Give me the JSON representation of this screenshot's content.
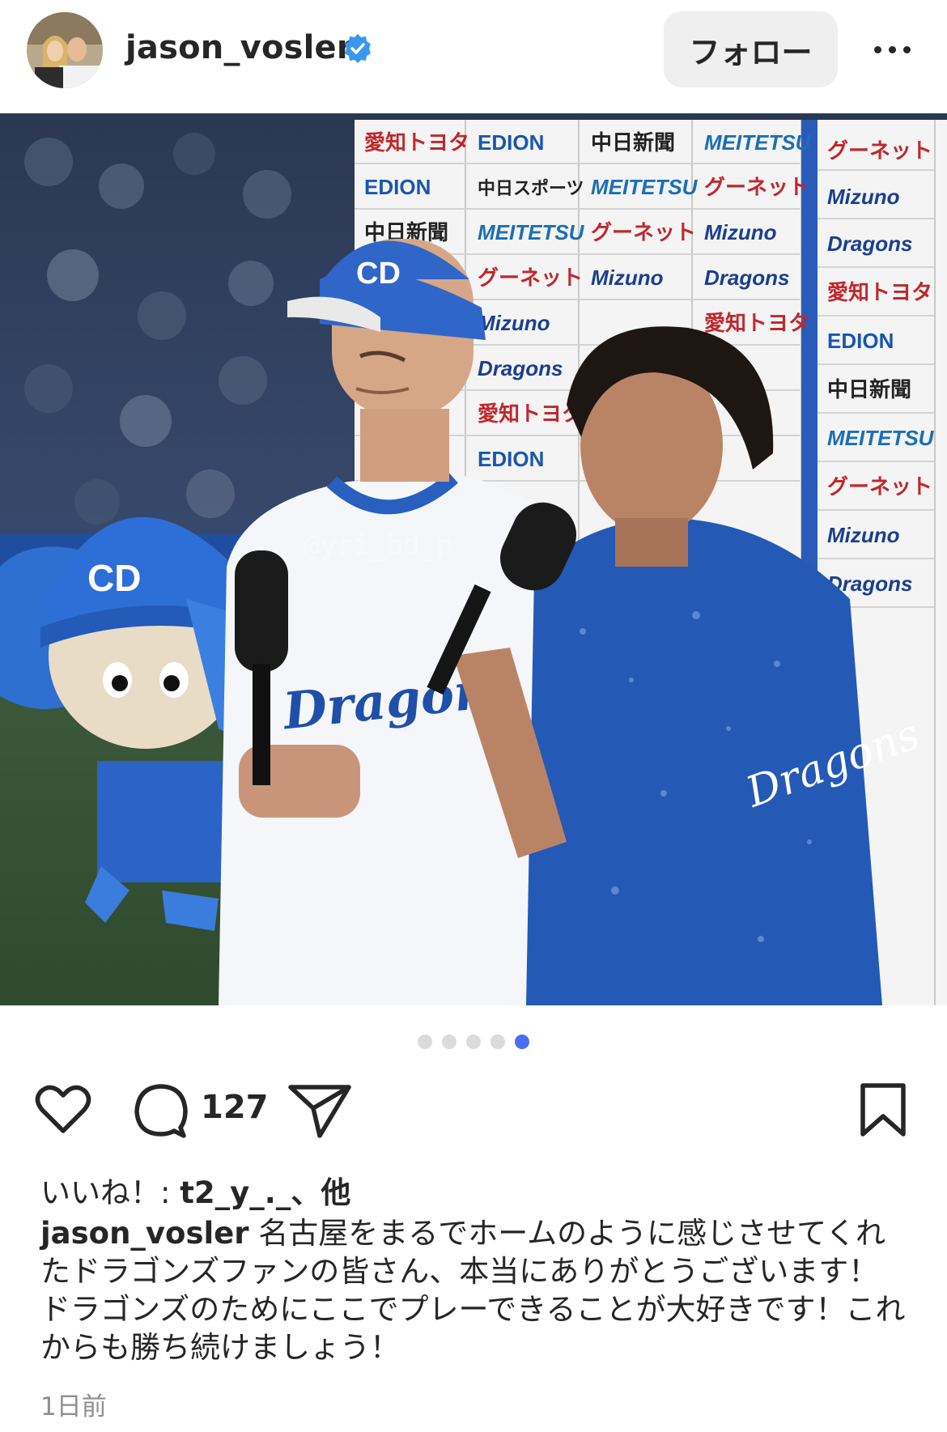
{
  "header": {
    "username": "jason_vosler",
    "follow_label": "フォロー"
  },
  "photo": {
    "watermark": "@yri_bd_p",
    "sponsors": [
      "愛知トヨタ",
      "EDION",
      "中日新聞",
      "MEITETSU",
      "グーネット",
      "中日スポーツ",
      "Mizuno",
      "Dragons"
    ],
    "carousel_count": 5,
    "carousel_active": 5
  },
  "actions": {
    "comment_count": "127"
  },
  "likes": {
    "prefix": "いいね！: ",
    "user": "t2_y_._",
    "suffix": "、他"
  },
  "caption": {
    "username": "jason_vosler",
    "text": "名古屋をまるでホームのように感じさせてくれたドラゴンズファンの皆さん、本当にありがとうございます！ドラゴンズのためにここでプレーできることが大好きです！これからも勝ち続けましょう！"
  },
  "timestamp": "1日前",
  "colors": {
    "verified": "#3897f0",
    "active_dot": "#4c6ef5",
    "dragons_blue": "#1f5fbf"
  }
}
